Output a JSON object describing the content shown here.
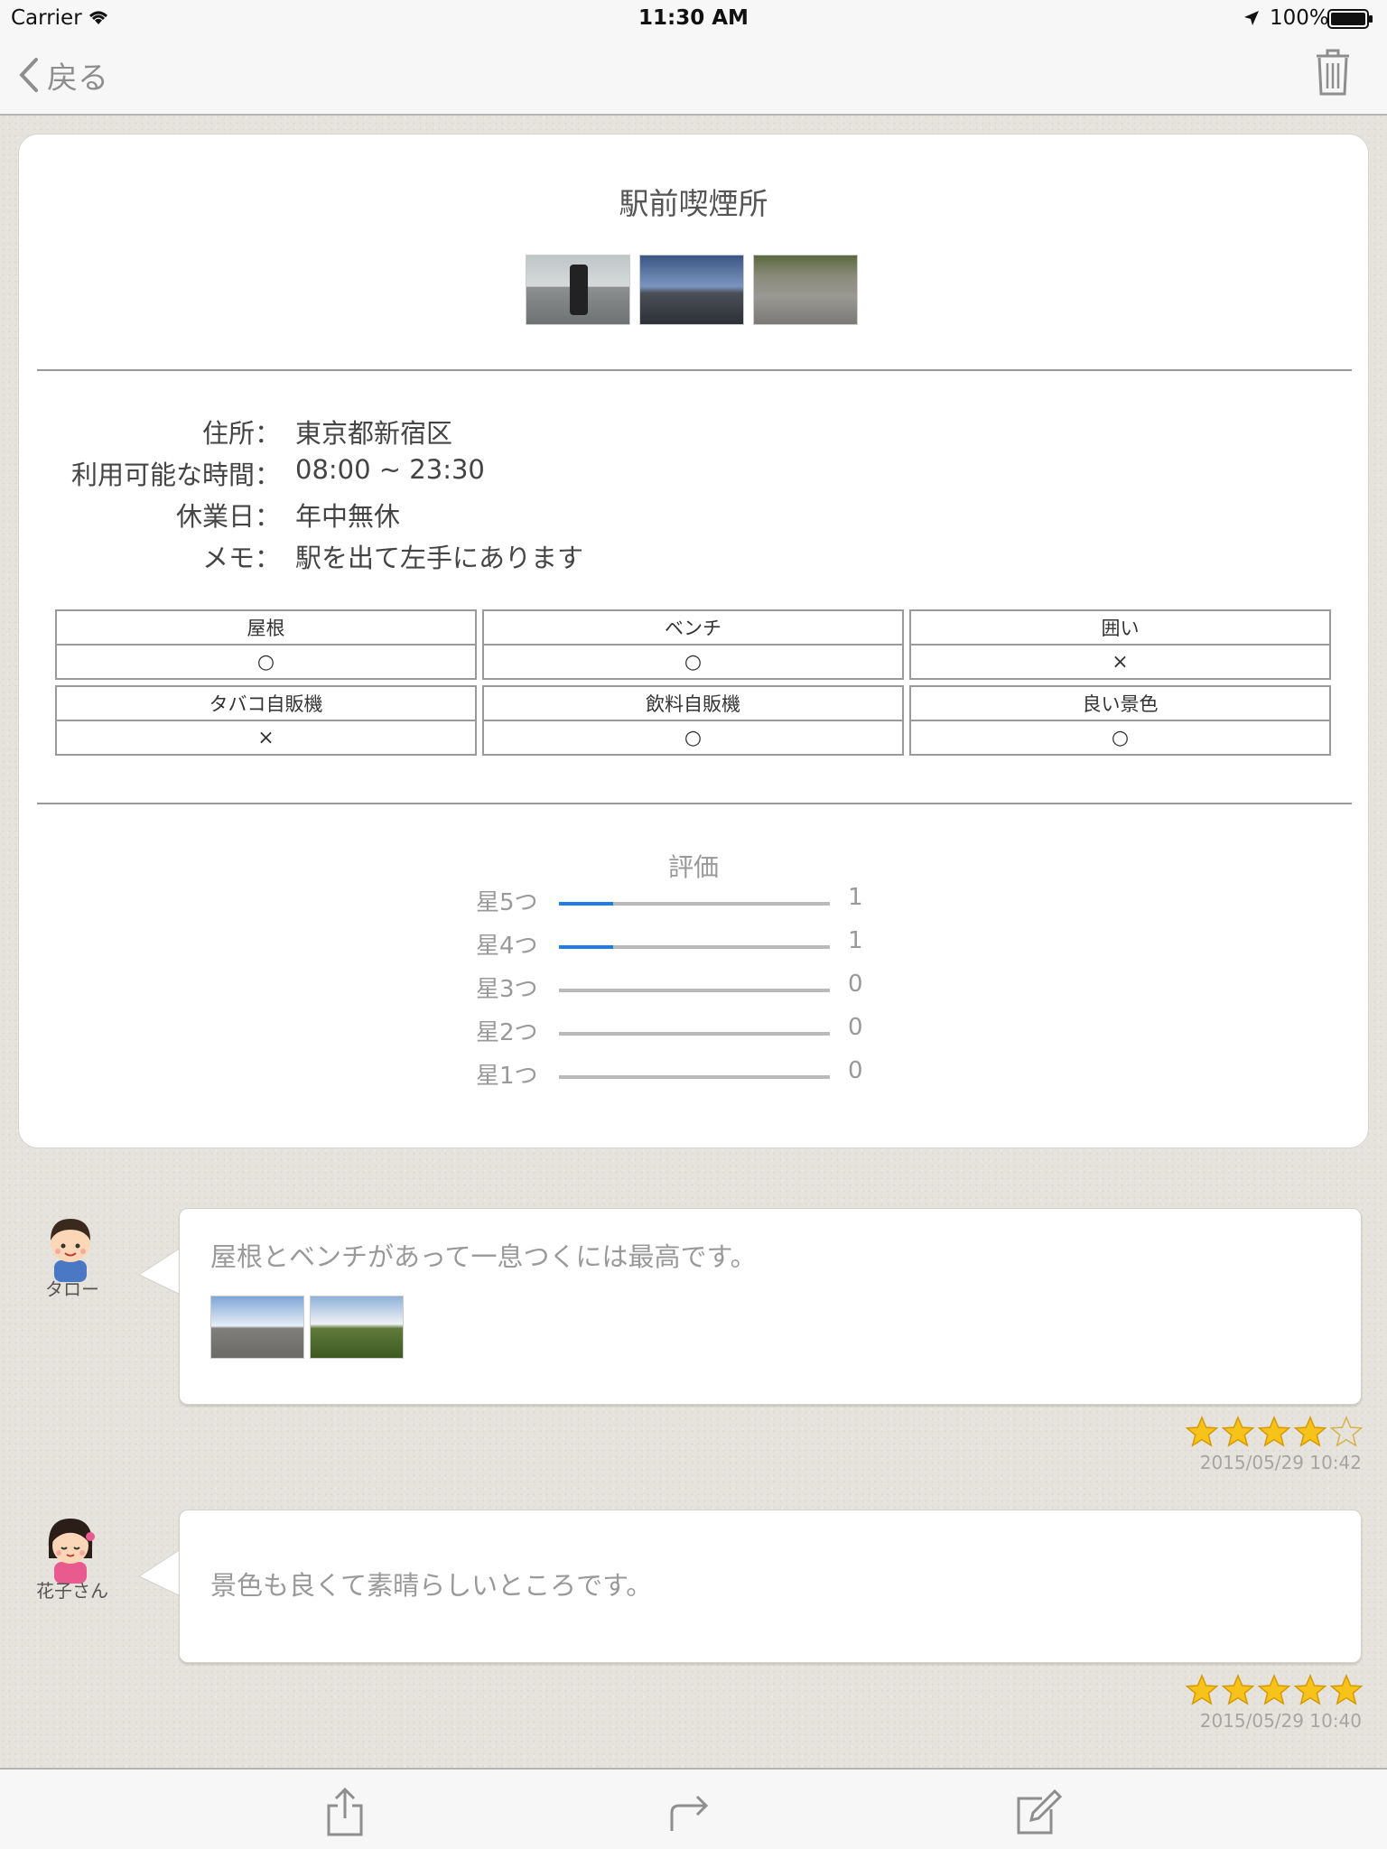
{
  "status_bar": {
    "carrier": "Carrier",
    "time": "11:30 AM",
    "battery": "100%"
  },
  "nav": {
    "back_label": "戻る"
  },
  "spot": {
    "name": "駅前喫煙所",
    "details": [
      {
        "label": "住所：",
        "value": "東京都新宿区"
      },
      {
        "label": "利用可能な時間：",
        "value": "08:00 ~ 23:30"
      },
      {
        "label": "休業日：",
        "value": "年中無休"
      },
      {
        "label": "メモ：",
        "value": "駅を出て左手にあります"
      }
    ],
    "facilities": [
      {
        "name": "屋根",
        "value": "○"
      },
      {
        "name": "ベンチ",
        "value": "○"
      },
      {
        "name": "囲い",
        "value": "×"
      },
      {
        "name": "タバコ自販機",
        "value": "×"
      },
      {
        "name": "飲料自販機",
        "value": "○"
      },
      {
        "name": "良い景色",
        "value": "○"
      }
    ]
  },
  "rating": {
    "title": "評価",
    "rows": [
      {
        "label": "星5つ",
        "count": "1",
        "fraction": 0.2
      },
      {
        "label": "星4つ",
        "count": "1",
        "fraction": 0.2
      },
      {
        "label": "星3つ",
        "count": "0",
        "fraction": 0
      },
      {
        "label": "星2つ",
        "count": "0",
        "fraction": 0
      },
      {
        "label": "星1つ",
        "count": "0",
        "fraction": 0
      }
    ]
  },
  "reviews": [
    {
      "user": "タロー",
      "comment": "屋根とベンチがあって一息つくには最高です。",
      "stars": 4,
      "date": "2015/05/29 10:42",
      "photo_count": 2
    },
    {
      "user": "花子さん",
      "comment": "景色も良くて素晴らしいところです。",
      "stars": 5,
      "date": "2015/05/29 10:40",
      "photo_count": 0
    }
  ],
  "colors": {
    "accent": "#1e7ee6",
    "star": "#f7c31a",
    "muted": "#999999"
  },
  "icons": [
    "back-chevron-icon",
    "trash-icon",
    "share-icon",
    "forward-icon",
    "edit-icon"
  ]
}
